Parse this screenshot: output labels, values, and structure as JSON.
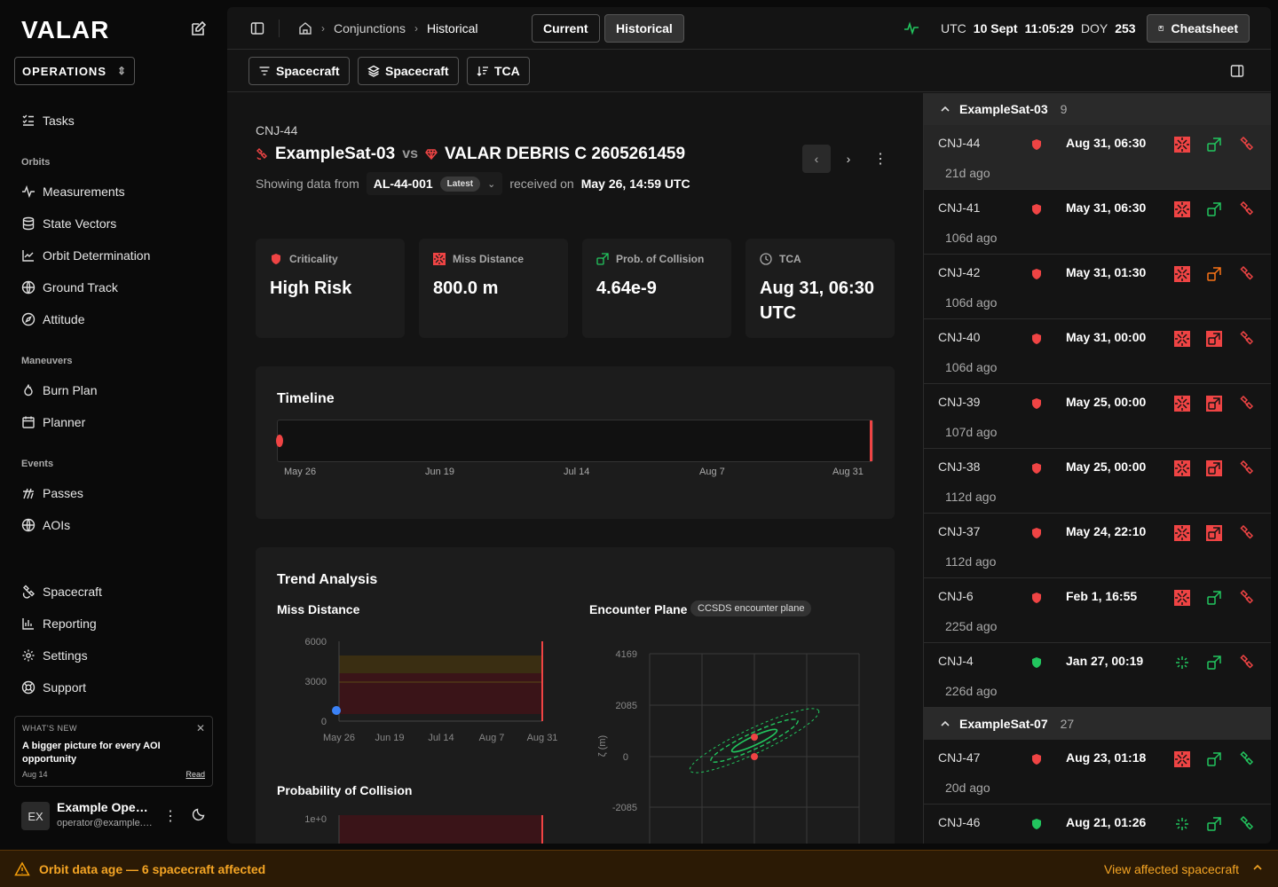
{
  "sidebar": {
    "logo": "VALAR",
    "workspace": "OPERATIONS",
    "tasks": "Tasks",
    "sections": {
      "orbits": "Orbits",
      "maneuvers": "Maneuvers",
      "events": "Events"
    },
    "items": {
      "measurements": "Measurements",
      "state_vectors": "State Vectors",
      "orbit_determination": "Orbit Determination",
      "ground_track": "Ground Track",
      "attitude": "Attitude",
      "burn_plan": "Burn Plan",
      "planner": "Planner",
      "passes": "Passes",
      "aois": "AOIs",
      "spacecraft": "Spacecraft",
      "reporting": "Reporting",
      "settings": "Settings",
      "support": "Support"
    },
    "whats_new": {
      "label": "WHAT'S NEW",
      "title": "A bigger picture for every AOI opportunity",
      "date": "Aug 14",
      "read": "Read"
    },
    "user": {
      "initials": "EX",
      "name": "Example Operator",
      "email": "operator@example.com"
    }
  },
  "topbar": {
    "breadcrumb": [
      "Conjunctions",
      "Historical"
    ],
    "current_btn": "Current",
    "historical_btn": "Historical",
    "utc_label": "UTC",
    "date": "10 Sept",
    "time": "11:05:29",
    "doy_label": "DOY",
    "doy": "253",
    "cheatsheet": "Cheatsheet"
  },
  "filters": {
    "filter1": "Spacecraft",
    "filter2": "Spacecraft",
    "sort": "TCA"
  },
  "detail": {
    "id": "CNJ-44",
    "primary": "ExampleSat-03",
    "vs": "vs",
    "secondary": "VALAR DEBRIS C 2605261459",
    "showing_label": "Showing data from",
    "dataset": "AL-44-001",
    "latest": "Latest",
    "received_label": "received on",
    "received": "May 26, 14:59 UTC",
    "stats": {
      "criticality_label": "Criticality",
      "criticality": "High Risk",
      "miss_label": "Miss Distance",
      "miss": "800.0 m",
      "prob_label": "Prob. of Collision",
      "prob": "4.64e-9",
      "tca_label": "TCA",
      "tca": "Aug 31, 06:30 UTC"
    },
    "timeline": {
      "title": "Timeline",
      "labels": [
        "May 26",
        "Jun 19",
        "Jul 14",
        "Aug 7",
        "Aug 31"
      ]
    },
    "trend": {
      "title": "Trend Analysis",
      "miss_title": "Miss Distance",
      "prob_title": "Probability of Collision",
      "encounter_title": "Encounter Plane",
      "encounter_pill": "CCSDS encounter plane"
    }
  },
  "chart_data": [
    {
      "type": "scatter",
      "title": "Miss Distance",
      "x": [
        "May 26"
      ],
      "values": [
        800
      ],
      "categories": [
        "May 26",
        "Jun 19",
        "Jul 14",
        "Aug 7",
        "Aug 31"
      ],
      "yticks": [
        "6000",
        "3000",
        "0"
      ],
      "ylim": [
        0,
        6000
      ]
    },
    {
      "type": "scatter",
      "title": "Encounter Plane",
      "ylabel": "ζ (m)",
      "yticks": [
        "4169",
        "2085",
        "0",
        "-2085"
      ]
    },
    {
      "type": "line",
      "title": "Probability of Collision",
      "yticks": [
        "1e+0"
      ]
    }
  ],
  "right_panel": {
    "groups": [
      {
        "name": "ExampleSat-03",
        "count": "9",
        "rows": [
          {
            "id": "CNJ-44",
            "ago": "21d ago",
            "time": "Aug 31, 06:30"
          },
          {
            "id": "CNJ-41",
            "ago": "106d ago",
            "time": "May 31, 06:30"
          },
          {
            "id": "CNJ-42",
            "ago": "106d ago",
            "time": "May 31, 01:30"
          },
          {
            "id": "CNJ-40",
            "ago": "106d ago",
            "time": "May 31, 00:00"
          },
          {
            "id": "CNJ-39",
            "ago": "107d ago",
            "time": "May 25, 00:00"
          },
          {
            "id": "CNJ-38",
            "ago": "112d ago",
            "time": "May 25, 00:00"
          },
          {
            "id": "CNJ-37",
            "ago": "112d ago",
            "time": "May 24, 22:10"
          },
          {
            "id": "CNJ-6",
            "ago": "225d ago",
            "time": "Feb 1, 16:55"
          },
          {
            "id": "CNJ-4",
            "ago": "226d ago",
            "time": "Jan 27, 00:19"
          }
        ]
      },
      {
        "name": "ExampleSat-07",
        "count": "27",
        "rows": [
          {
            "id": "CNJ-47",
            "ago": "20d ago",
            "time": "Aug 23, 01:18"
          },
          {
            "id": "CNJ-46",
            "ago": "",
            "time": "Aug 21, 01:26"
          }
        ]
      }
    ]
  },
  "banner": {
    "text": "Orbit data age — 6 spacecraft affected",
    "link": "View affected spacecraft"
  },
  "colors": {
    "danger": "#ef4444",
    "success": "#22c55e",
    "warning": "#f59e0b",
    "orange": "#f97316"
  }
}
